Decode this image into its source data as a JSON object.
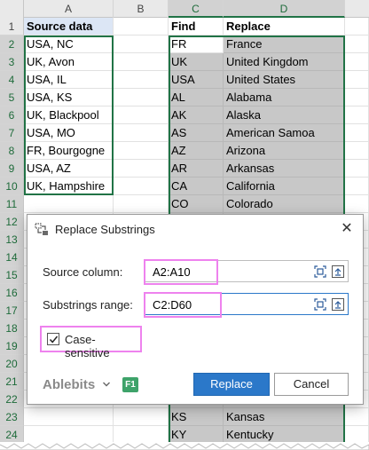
{
  "sheet": {
    "columns": [
      "A",
      "B",
      "C",
      "D"
    ],
    "rows": [
      "1",
      "2",
      "3",
      "4",
      "5",
      "6",
      "7",
      "8",
      "9",
      "10",
      "11",
      "12",
      "13",
      "14",
      "15",
      "16",
      "17",
      "18",
      "19",
      "20",
      "21",
      "22",
      "23",
      "24"
    ],
    "col_a": [
      "Source data",
      "USA, NC",
      "UK, Avon",
      "USA, IL",
      "USA, KS",
      "UK, Blackpool",
      "USA, MO",
      "FR, Bourgogne",
      "USA, AZ",
      "UK, Hampshire"
    ],
    "col_c": [
      "Find",
      "FR",
      "UK",
      "USA",
      "AL",
      "AK",
      "AS",
      "AZ",
      "AR",
      "CA",
      "CO"
    ],
    "col_d": [
      "Replace",
      "France",
      "United Kingdom",
      "United States",
      "Alabama",
      "Alaska",
      "American Samoa",
      "Arizona",
      "Arkansas",
      "California",
      "Colorado"
    ],
    "row23": {
      "c": "KS",
      "d": "Kansas"
    },
    "row24": {
      "c": "KY",
      "d": "Kentucky"
    }
  },
  "dialog": {
    "title": "Replace Substrings",
    "title_icon": "replace-substrings-icon",
    "source_label": "Source column:",
    "source_value": "A2:A10",
    "range_label": "Substrings range:",
    "range_value": "C2:D60",
    "case_sensitive_label": "Case-sensitive",
    "case_sensitive_checked": true,
    "brand": "Ablebits",
    "f1_label": "F1",
    "replace_button": "Replace",
    "cancel_button": "Cancel",
    "highlight_color": "#ee82ee",
    "accent_color": "#2b78c9"
  }
}
